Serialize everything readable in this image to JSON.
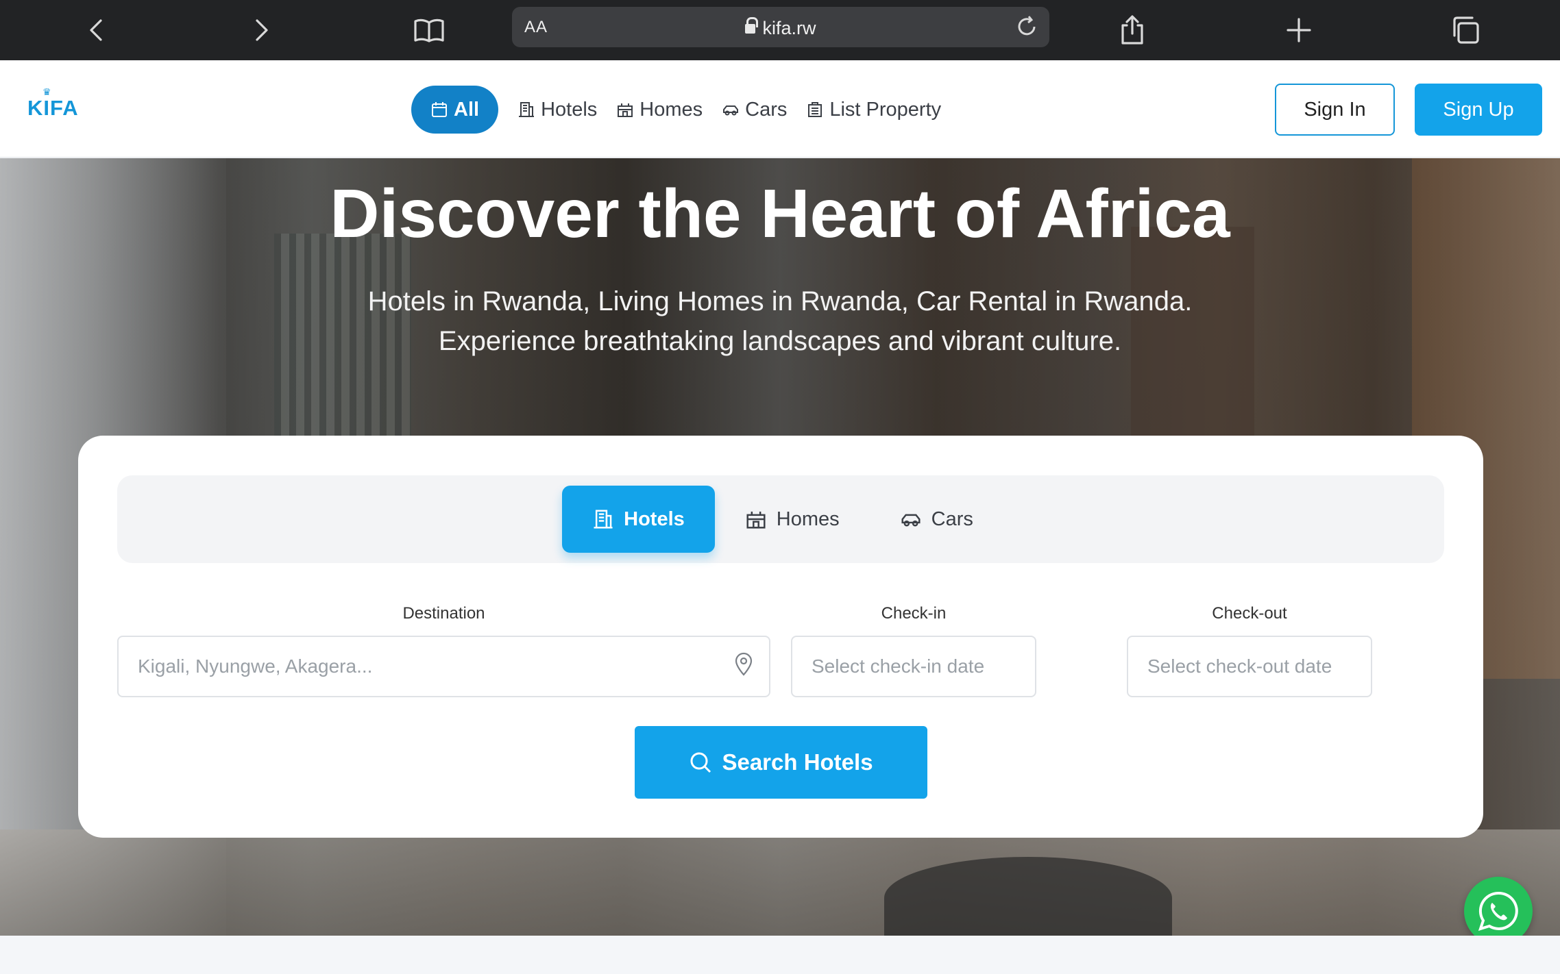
{
  "browser": {
    "text_size_label": "AA",
    "url": "kifa.rw"
  },
  "header": {
    "logo": "KIFA",
    "nav": [
      {
        "label": "All",
        "icon": "calendar-icon",
        "active": true
      },
      {
        "label": "Hotels",
        "icon": "building-icon"
      },
      {
        "label": "Homes",
        "icon": "home-icon"
      },
      {
        "label": "Cars",
        "icon": "car-icon"
      },
      {
        "label": "List Property",
        "icon": "list-property-icon"
      }
    ],
    "sign_in": "Sign In",
    "sign_up": "Sign Up"
  },
  "hero": {
    "title": "Discover the Heart of Africa",
    "subtitle_line1": "Hotels in Rwanda, Living Homes in Rwanda, Car Rental in Rwanda.",
    "subtitle_line2": "Experience breathtaking landscapes and vibrant culture."
  },
  "search": {
    "tabs": [
      {
        "label": "Hotels",
        "icon": "building-icon",
        "active": true
      },
      {
        "label": "Homes",
        "icon": "home-icon"
      },
      {
        "label": "Cars",
        "icon": "car-icon"
      }
    ],
    "destination": {
      "label": "Destination",
      "placeholder": "Kigali, Nyungwe, Akagera...",
      "value": ""
    },
    "checkin": {
      "label": "Check-in",
      "placeholder": "Select check-in date",
      "value": ""
    },
    "checkout": {
      "label": "Check-out",
      "placeholder": "Select check-out date",
      "value": ""
    },
    "button": "Search Hotels"
  },
  "colors": {
    "primary": "#13a3ea",
    "nav_active": "#1281c7",
    "whatsapp": "#25c05a"
  }
}
